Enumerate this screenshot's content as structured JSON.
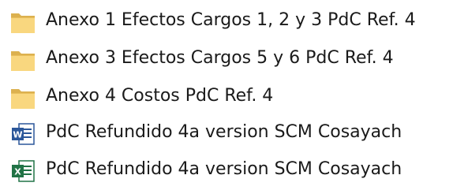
{
  "explorer": {
    "items": [
      {
        "name": "Anexo 1 Efectos Cargos 1, 2 y 3 PdC Ref. 4",
        "type": "folder",
        "icon": "folder-icon"
      },
      {
        "name": "Anexo 3 Efectos Cargos 5 y 6 PdC Ref. 4",
        "type": "folder",
        "icon": "folder-icon"
      },
      {
        "name": "Anexo 4 Costos PdC Ref. 4",
        "type": "folder",
        "icon": "folder-icon"
      },
      {
        "name": "PdC Refundido 4a version SCM Cosayach",
        "type": "word-document",
        "icon": "word-document-icon"
      },
      {
        "name": "PdC Refundido 4a version SCM Cosayach",
        "type": "excel-workbook",
        "icon": "excel-workbook-icon"
      }
    ]
  },
  "colors": {
    "folder_back": "#DCB14F",
    "folder_front": "#F9D77F",
    "word_blue": "#2B579A",
    "excel_green": "#217346",
    "text": "#1A1A1A"
  }
}
